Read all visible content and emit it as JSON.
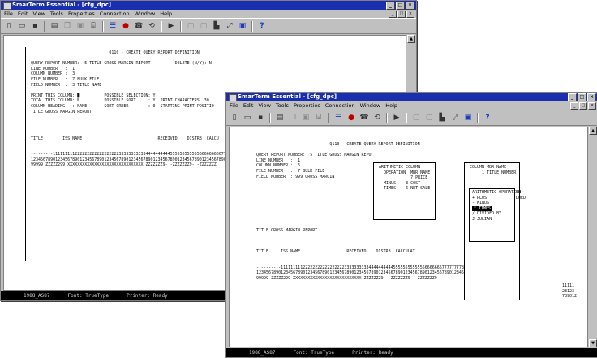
{
  "app_title": "SmarTerm Essential - [cfg_dpc]",
  "title_buttons": [
    "_",
    "□",
    "×"
  ],
  "menu": [
    "File",
    "Edit",
    "View",
    "Tools",
    "Properties",
    "Connection",
    "Window",
    "Help"
  ],
  "mdi_buttons": [
    "_",
    "□",
    "×"
  ],
  "toolbar_icons": [
    {
      "name": "new-icon",
      "glyph": "▯"
    },
    {
      "name": "open-icon",
      "glyph": "▭"
    },
    {
      "name": "save-icon",
      "glyph": "▪"
    },
    {
      "name": "print-icon",
      "glyph": "▤"
    },
    {
      "name": "copy-icon",
      "glyph": "❐"
    },
    {
      "name": "paste-icon",
      "glyph": "▣"
    },
    {
      "name": "macro-icon",
      "glyph": "⌸"
    },
    {
      "name": "properties-icon",
      "glyph": "☰"
    },
    {
      "name": "record-icon",
      "glyph": "●"
    },
    {
      "name": "connect-icon",
      "glyph": "☎"
    },
    {
      "name": "disconnect-icon",
      "glyph": "⟲"
    },
    {
      "name": "play-icon",
      "glyph": "▶"
    },
    {
      "name": "session-icon-1",
      "glyph": "▢"
    },
    {
      "name": "session-icon-2",
      "glyph": "▢"
    },
    {
      "name": "file-transfer-icon",
      "glyph": "▙"
    },
    {
      "name": "hotspot-icon",
      "glyph": "⤢"
    },
    {
      "name": "window-icon",
      "glyph": "▣"
    },
    {
      "name": "help-icon",
      "glyph": "?"
    }
  ],
  "scroll_up": "▲",
  "scroll_down": "▼",
  "terminal_back": "                                 Q110 - CREATE QUERY REPORT DEFINITION\n\n QUERY REPORT NUMBER:  5 TITLE GROSS MARGIN REPORT          DELETE (N/Y): N\n LINE NUMBER   :  1\n COLUMN NUMBER :  3\n FILE NUMBER   :  7 BULK FILE\n FIELD NUMBER  :  3 TITLE NAME\n\n PRINT THIS COLUMN: █          POSSIBLE SELECTION: Y\n TOTAL THIS COLUMN: N          POSSIBLE SORT     : Y  PRINT CHARACTERS  30\n COLUMN HEADING   : NAME       SORT ORDER        : 0  STARTING PRINT POSITIO\n TITLE GROSS MARGIN REPORT\n\n\n\n\n TITLE        ISS NAME                               RECEIVED    DISTRB  CALCU\n\n\n ---------111111111222222222222222222333333333334444444444555555555555666666666777777\n 123456789012345678901234567890123456789012345678901234567890123456789012345678901234\n 99999 ZZZZZ299 XXXXXXXXXXXXXXXXXXXXXXXXXXXXXXX ZZZZZZZ9- -ZZZZZZZ9- -ZZZZZZZ",
  "terminal_front": "                               Q110 - CREATE QUERY REPORT DEFINITION\n\n QUERY REPORT NUMBER:  5 TITLE GROSS MARGIN REPO\n LINE NUMBER   :  1\n COLUMN NUMBER :  5\n FILE NUMBER   :  7 BULK FILE\n FIELD NUMBER  : 999 GROSS MARGIN______\n\n\n\n\n\n\n\n\n\n TITLE GROSS MARGIN REPORT\n\n\n\n TITLE     ISS NAME                   RECEIVED    DISTRB  CALCULAT\n\n\n ----------11111111122222222222222222333333333344444444445555555555555666666677777777888888888\n 1234567890123456789012345678901234567890123456789012345678901234567890123456789012345678901234\n 99999 ZZZZZ299 XXXXXXXXXXXXXXXXXXXXXXXXXXXX ZZZZZZZ9- -ZZZZZZZ9- -ZZZZZZZ9--",
  "popup_arith": " ARITHMETIC COLUMN\n   OPERATION  MBR NAME\n              7 PRICE\n   MINUS    3 COST\n   TIMES    6 NET SALE",
  "popup_colmbr": " COLUMN MBR NAME\n      1 TITLE NUMBER\n\n\n\n\n\n\n\n\n\n\n\n\n\n\n\n\n\n\n\n\n\n",
  "op_menu_title": "ARITHMETIC OPERATION",
  "op_items": [
    "+ PLUS",
    "- MINUS",
    "* TIMES",
    "/ DIVIDED BY",
    "J JULIAN"
  ],
  "op_selected_index": 2,
  "op_side_text": "ED\nDUED",
  "right_edge_text": "11111\n23123\n789012",
  "status": {
    "conn": "1988_AS87",
    "font": "Font: TrueType",
    "printer": "Printer: Ready"
  }
}
